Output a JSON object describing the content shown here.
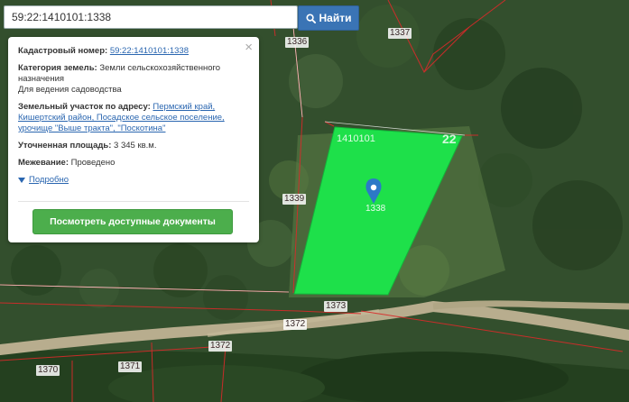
{
  "search": {
    "value": "59:22:1410101:1338",
    "button_label": "Найти",
    "icon": "search-icon"
  },
  "info_panel": {
    "close_glyph": "×",
    "cadastral_number_label": "Кадастровый номер:",
    "cadastral_number_value": "59:22:1410101:1338",
    "land_category_label": "Категория земель:",
    "land_category_value_1": "Земли сельскохозяйственного",
    "land_category_value_2": "назначения",
    "permitted_use": "Для ведения садоводства",
    "address_label": "Земельный участок по адресу:",
    "address_value_1": "Пермский край,",
    "address_value_2": "Кишертский район, Посадское сельское поселение,",
    "address_value_3": "урочище \"Выше тракта\", \"Поскотина\"",
    "area_label": "Уточненная площадь:",
    "area_value": "3 345 кв.м.",
    "survey_label": "Межевание:",
    "survey_value": "Проведено",
    "details_link": "Подробно",
    "documents_button": "Посмотреть доступные документы"
  },
  "map": {
    "parcel_labels": [
      "1336",
      "1337",
      "1339",
      "1372",
      "1373",
      "1372",
      "1370",
      "1371"
    ],
    "quarter_label": "1410101",
    "zone_label": "22",
    "selected_parcel_label": "1338",
    "colors": {
      "selected_parcel_fill": "#1ee04a",
      "boundary": "#d92a2a",
      "accent_button": "#3a74b5",
      "docs_button": "#4cae4c"
    }
  }
}
